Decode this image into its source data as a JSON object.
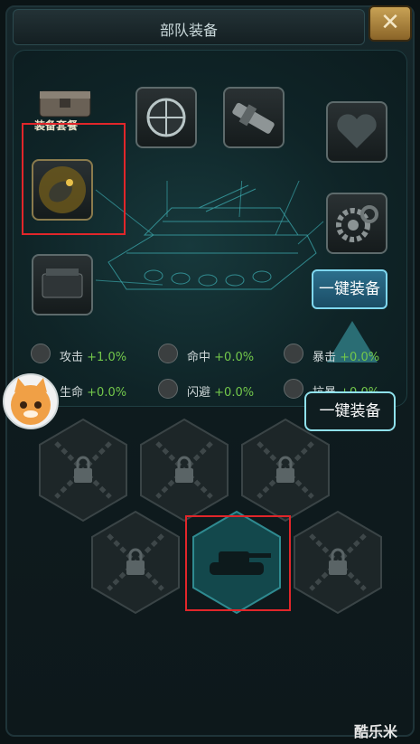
{
  "header": {
    "title": "部队装备",
    "close_label": "✕"
  },
  "equipment": {
    "set_label": "装备套餐",
    "slots": [
      {
        "name": "shell",
        "icon": "shell-icon"
      },
      {
        "name": "scope",
        "icon": "scope-icon"
      },
      {
        "name": "barrel",
        "icon": "barrel-icon"
      },
      {
        "name": "armor-core",
        "icon": "heart-icon"
      },
      {
        "name": "gear",
        "icon": "gear-icon"
      },
      {
        "name": "engine",
        "icon": "engine-icon"
      }
    ],
    "one_key_label": "一键装备"
  },
  "stats": [
    {
      "name": "攻击",
      "value": "+1.0%"
    },
    {
      "name": "命中",
      "value": "+0.0%"
    },
    {
      "name": "暴击",
      "value": "+0.0%"
    },
    {
      "name": "生命",
      "value": "+0.0%"
    },
    {
      "name": "闪避",
      "value": "+0.0%"
    },
    {
      "name": "抗暴",
      "value": "+0.0%"
    }
  ],
  "tooltip": {
    "label": "一键装备"
  },
  "units": {
    "slots": [
      "locked",
      "locked",
      "locked",
      "locked",
      "tank",
      "locked"
    ]
  },
  "watermark": "酷乐米",
  "colors": {
    "stat_value": "#73c84b",
    "highlight_box": "#e1262a",
    "accent": "#7fd7ef"
  }
}
